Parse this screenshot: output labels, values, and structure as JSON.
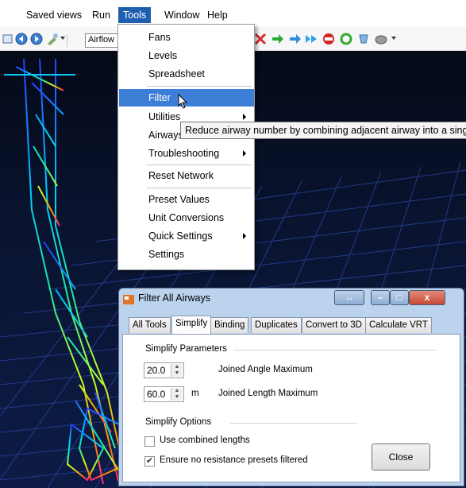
{
  "menubar": {
    "items": [
      "Saved views",
      "Run",
      "Tools",
      "Window",
      "Help"
    ],
    "active": "Tools"
  },
  "toolbar": {
    "combo_value": "Airflow",
    "icons": [
      "edit-icon",
      "back-icon",
      "forward-icon",
      "tools-icon",
      "arrow-right-green-icon",
      "arrow-right-blue-icon",
      "double-arrow-icon",
      "stop-icon",
      "recycle-icon",
      "shield-icon",
      "cloud-icon"
    ]
  },
  "tools_menu": {
    "items": [
      {
        "label": "Fans",
        "submenu": false
      },
      {
        "label": "Levels",
        "submenu": false
      },
      {
        "label": "Spreadsheet",
        "submenu": false
      },
      {
        "label": "Filter",
        "submenu": false,
        "highlighted": true
      },
      {
        "label": "Utilities",
        "submenu": true
      },
      {
        "label": "Airways",
        "submenu": false
      },
      {
        "label": "Troubleshooting",
        "submenu": true
      },
      {
        "label": "Reset Network",
        "submenu": false
      },
      {
        "label": "Preset Values",
        "submenu": false
      },
      {
        "label": "Unit Conversions",
        "submenu": false
      },
      {
        "label": "Quick Settings",
        "submenu": true
      },
      {
        "label": "Settings",
        "submenu": false
      }
    ],
    "tooltip": "Reduce airway number by combining adjacent airway into a sing"
  },
  "dialog": {
    "title": "Filter All Airways",
    "tabs": [
      "All Tools",
      "Simplify",
      "Binding",
      "Duplicates",
      "Convert to 3D",
      "Calculate VRT"
    ],
    "selected_tab": "Simplify",
    "simplify_parameters_label": "Simplify Parameters",
    "angle": {
      "value": "20.0",
      "label": "Joined Angle Maximum"
    },
    "length": {
      "value": "60.0",
      "unit": "m",
      "label": "Joined Length Maximum"
    },
    "simplify_options_label": "Simplify Options",
    "options": [
      {
        "label": "Use combined lengths",
        "checked": false
      },
      {
        "label": "Ensure no resistance presets filtered",
        "checked": true
      }
    ],
    "close_label": "Close"
  }
}
